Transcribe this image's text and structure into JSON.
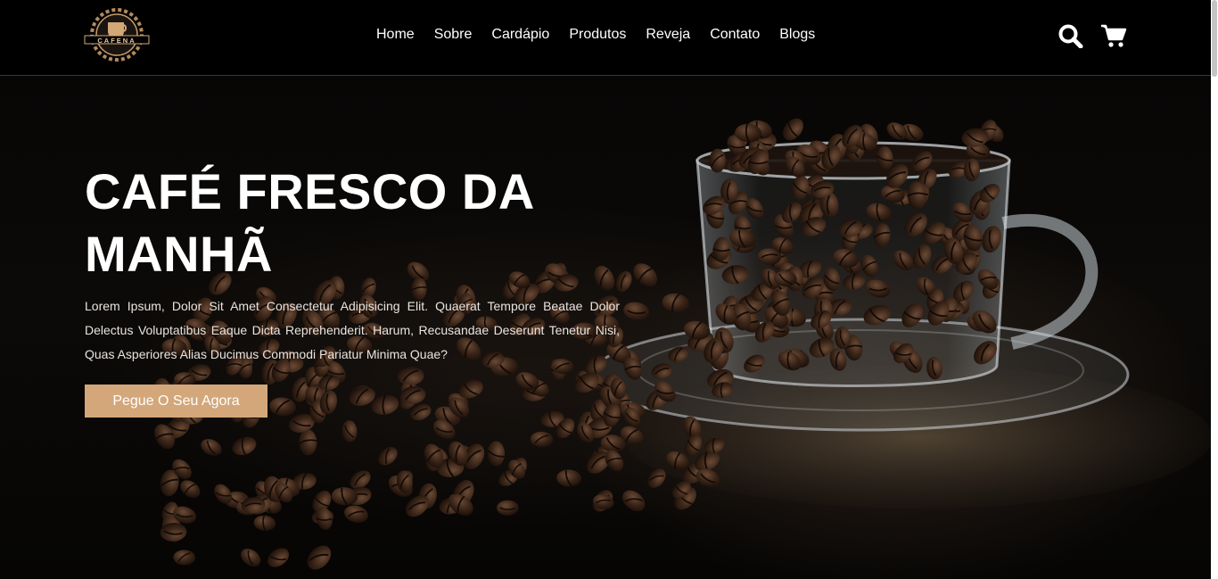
{
  "header": {
    "logo_text": "CAFENA",
    "nav": [
      "Home",
      "Sobre",
      "Cardápio",
      "Produtos",
      "Reveja",
      "Contato",
      "Blogs"
    ],
    "icons": [
      "search-icon",
      "cart-icon"
    ]
  },
  "hero": {
    "title": "CAFÉ FRESCO DA MANHÃ",
    "text": "Lorem Ipsum, Dolor Sit Amet Consectetur Adipisicing Elit. Quaerat Tempore Beatae Dolor Delectus Voluptatibus Eaque Dicta Reprehenderit. Harum, Recusandae Deserunt Tenetur Nisi, Quas Asperiores Alias Ducimus Commodi Pariatur Minima Quae?",
    "cta_label": "Pegue O Seu Agora",
    "image": "coffee-beans-glass-cup"
  },
  "colors": {
    "header_bg": "#000000",
    "accent": "#d3a77a",
    "text": "#ffffff"
  }
}
